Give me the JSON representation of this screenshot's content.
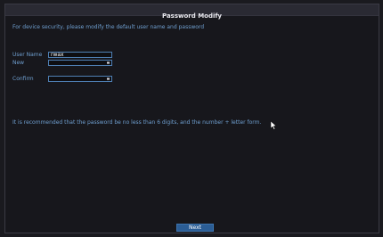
{
  "window": {
    "title": "Password Modify"
  },
  "intro_text": "For device security, please modify the default user name and password",
  "form": {
    "username": {
      "label": "User Name",
      "value": "rwax"
    },
    "new_password": {
      "label": "New",
      "value": ""
    },
    "confirm_password": {
      "label": "Confirm",
      "value": ""
    }
  },
  "hint_text": "It is recommended that the password be no less than 6 digits, and the number + letter form.",
  "buttons": {
    "next_label": "Next"
  },
  "colors": {
    "background": "#17171c",
    "label_blue": "#6f9fd0",
    "field_border": "#4f80b4",
    "button_blue": "#2b5d95"
  }
}
